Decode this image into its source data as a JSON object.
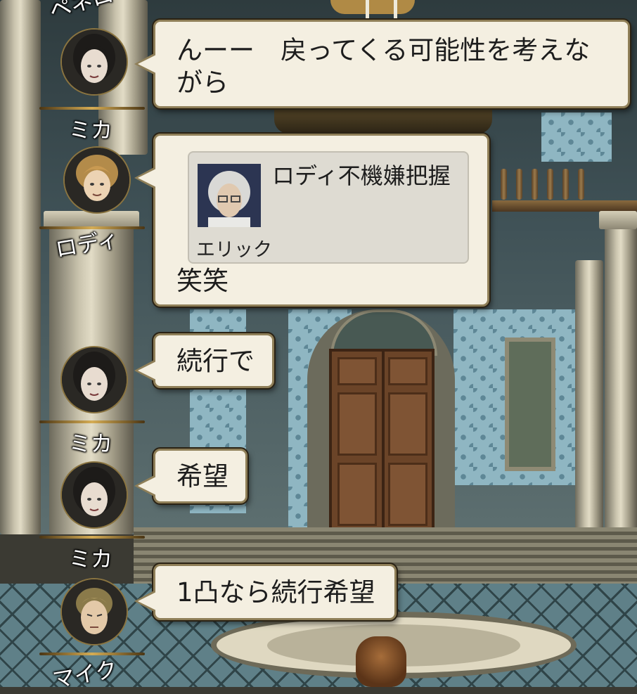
{
  "chat": {
    "messages": [
      {
        "speaker": "ミカ",
        "text": "んーー　戻ってくる可能性を考えながら"
      },
      {
        "speaker": "ロディ",
        "quote": {
          "speaker": "エリック",
          "text": "ロディ不機嫌把握"
        },
        "text": "笑笑"
      },
      {
        "speaker": "ミカ",
        "text": "続行で"
      },
      {
        "speaker": "ミカ",
        "text": "希望"
      },
      {
        "speaker": "マイク",
        "text": "1凸なら続行希望"
      }
    ],
    "partial_top_speaker": "ペネロペ"
  },
  "colors": {
    "bubble_bg": "#f4efe1",
    "bubble_border": "#8f7f58",
    "name_text": "#ffffff"
  }
}
